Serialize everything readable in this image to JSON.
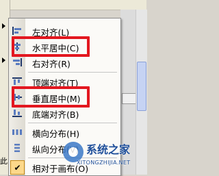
{
  "background": {
    "left_text": "此"
  },
  "menu": {
    "items": [
      {
        "label": "左对齐(L)",
        "icon": "align-left-icon"
      },
      {
        "label": "水平居中(C)",
        "icon": "align-center-icon"
      },
      {
        "label": "右对齐(R)",
        "icon": "align-right-icon"
      },
      {
        "label": "顶端对齐(T)",
        "icon": "align-top-icon"
      },
      {
        "label": "垂直居中(M)",
        "icon": "align-middle-icon"
      },
      {
        "label": "底端对齐(B)",
        "icon": "align-bottom-icon"
      },
      {
        "label": "横向分布(H)",
        "icon": "distribute-horizontal-icon"
      },
      {
        "label": "纵向分布(V)",
        "icon": "distribute-vertical-icon"
      },
      {
        "label": "相对于画布(O)",
        "icon": "check-icon",
        "checked": true
      }
    ]
  },
  "highlight_color": "#e3171f",
  "watermark": {
    "name": "系统之家",
    "url": "XITONGZHIJIA.NET"
  }
}
